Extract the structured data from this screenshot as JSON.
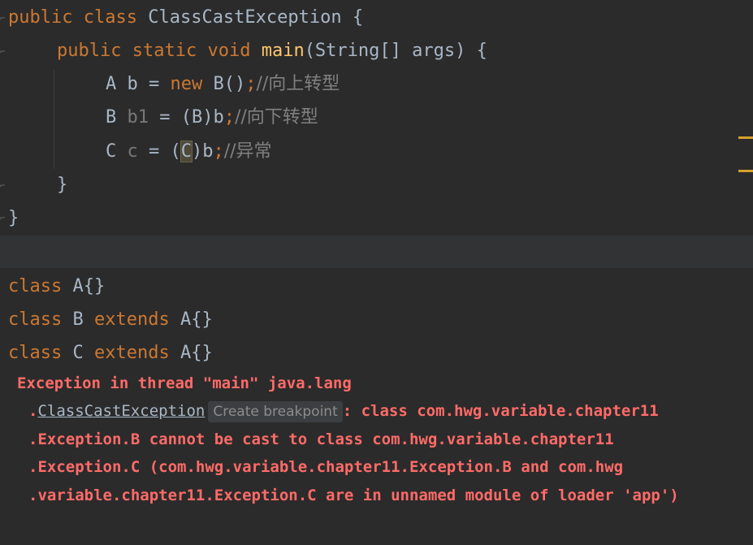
{
  "editor": {
    "line1": {
      "kw1": "public",
      "kw2": "class",
      "name": "ClassCastException",
      "brace": " {"
    },
    "line2": {
      "kw1": "public",
      "kw2": "static",
      "kw3": "void",
      "fn": "main",
      "rest": "(String[] args) {"
    },
    "line3": {
      "a": "A b = ",
      "kw": "new",
      "b": " B()",
      "semi": ";",
      "comment": "//向上转型"
    },
    "line4": {
      "a": "B ",
      "var": "b1",
      "b": " = (B)b",
      "semi": ";",
      "comment": "//向下转型"
    },
    "line5": {
      "a": "C ",
      "var": "c",
      "b": " = (",
      "cursor_char": "C",
      "c": ")b",
      "semi": ";",
      "comment": "//异常"
    },
    "line6": "}",
    "line7": "}"
  },
  "classes": [
    {
      "kw": "class",
      "name": " A{}"
    },
    {
      "kw": "class",
      "name": " B ",
      "kw2": "extends",
      "rest": " A{}"
    },
    {
      "kw": "class",
      "name": " C ",
      "kw2": "extends",
      "rest": " A{}"
    }
  ],
  "console": {
    "line1": "Exception in thread \"main\" java.lang",
    "line2_prefix": ".",
    "line2_link": "ClassCastException",
    "breakpoint_label": "Create breakpoint",
    "line2_rest": ": class com.hwg.variable.chapter11",
    "line3": ".Exception.B cannot be cast to class com.hwg.variable.chapter11",
    "line4": ".Exception.C (com.hwg.variable.chapter11.Exception.B and com.hwg",
    "line5": ".variable.chapter11.Exception.C are in unnamed module of loader 'app')"
  },
  "colors": {
    "background": "#2b2b2b",
    "keyword": "#cc7832",
    "function": "#ffc66d",
    "identifier": "#a9b7c6",
    "comment": "#808080",
    "error": "#ff6b68",
    "stripe_marker": "#d4a12a"
  }
}
